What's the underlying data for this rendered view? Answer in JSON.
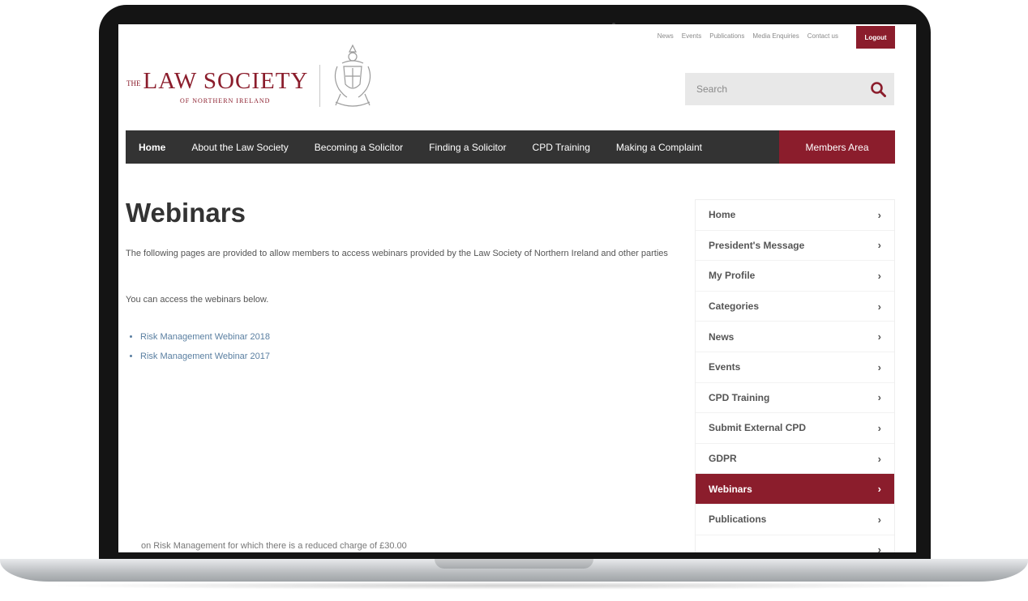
{
  "top_links": [
    "News",
    "Events",
    "Publications",
    "Media Enquiries",
    "Contact us"
  ],
  "logout_label": "Logout",
  "logo": {
    "prefix": "THE",
    "name": "LAW SOCIETY",
    "subtitle": "OF NORTHERN IRELAND"
  },
  "search": {
    "placeholder": "Search",
    "icon": "search-icon"
  },
  "nav": {
    "items": [
      "Home",
      "About the Law Society",
      "Becoming a Solicitor",
      "Finding a Solicitor",
      "CPD Training",
      "Making a Complaint"
    ],
    "members": "Members Area"
  },
  "main": {
    "title": "Webinars",
    "intro": "The following pages are provided to allow members to access webinars provided by the Law Society of Northern Ireland and other parties",
    "access_text": "You can access the webinars below.",
    "links": [
      "Risk Management Webinar 2018",
      "Risk Management Webinar 2017"
    ],
    "footer_note": "on Risk Management for which there is a reduced charge of £30.00"
  },
  "sidebar": {
    "items": [
      {
        "label": "Home",
        "active": false
      },
      {
        "label": "President's Message",
        "active": false
      },
      {
        "label": "My Profile",
        "active": false
      },
      {
        "label": "Categories",
        "active": false
      },
      {
        "label": "News",
        "active": false
      },
      {
        "label": "Events",
        "active": false
      },
      {
        "label": "CPD Training",
        "active": false
      },
      {
        "label": "Submit External CPD",
        "active": false
      },
      {
        "label": "GDPR",
        "active": false
      },
      {
        "label": "Webinars",
        "active": true
      },
      {
        "label": "Publications",
        "active": false
      },
      {
        "label": "",
        "active": false
      }
    ],
    "chevron": "›"
  },
  "colors": {
    "brand": "#8b1d2c",
    "nav_bg": "#333333",
    "link": "#5a7fa1"
  }
}
